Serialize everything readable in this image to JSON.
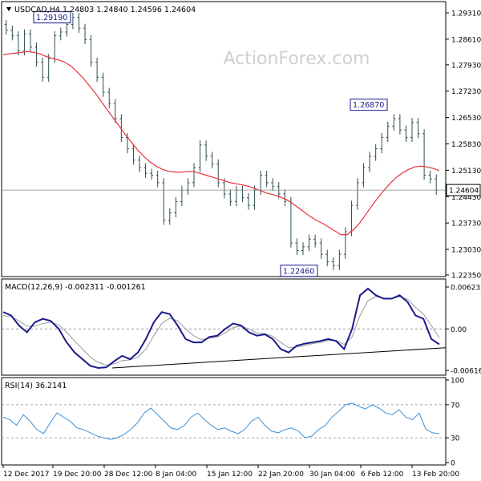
{
  "colors": {
    "background": "#ffffff",
    "frame": "#000000",
    "candle": "#2f4f4f",
    "ma": "#e8323a",
    "macd_main": "#1a1a8c",
    "macd_signal": "#9b9b9b",
    "rsi": "#3a8fd8",
    "level_line": "#8a8a8a",
    "label_border": "#1a1a8c",
    "watermark": "#d0d0d0"
  },
  "watermark": "ActionForex.com",
  "chart_data": [
    {
      "type": "candlestick",
      "title": "USDCAD,H4  1.24803 1.24840 1.24596 1.24604",
      "y_ticks": [
        "1.29310",
        "1.28610",
        "1.27930",
        "1.27230",
        "1.26530",
        "1.25830",
        "1.25130",
        "1.24430",
        "1.23730",
        "1.23030",
        "1.22350"
      ],
      "ylim": [
        1.2235,
        1.2931
      ],
      "current_price_label": "1.24604",
      "current_price": 1.24604,
      "annotations": [
        {
          "text": "1.29190",
          "value": 1.2919
        },
        {
          "text": "1.26870",
          "value": 1.2687
        },
        {
          "text": "1.22460",
          "value": 1.2246
        }
      ],
      "close": [
        1.2885,
        1.287,
        1.283,
        1.2875,
        1.284,
        1.28,
        1.276,
        1.281,
        1.287,
        1.288,
        1.29,
        1.2919,
        1.289,
        1.286,
        1.28,
        1.276,
        1.272,
        1.269,
        1.265,
        1.26,
        1.257,
        1.254,
        1.252,
        1.2505,
        1.25,
        1.248,
        1.238,
        1.24,
        1.243,
        1.246,
        1.248,
        1.252,
        1.258,
        1.255,
        1.253,
        1.248,
        1.245,
        1.243,
        1.246,
        1.244,
        1.242,
        1.246,
        1.25,
        1.248,
        1.247,
        1.245,
        1.243,
        1.232,
        1.23,
        1.231,
        1.233,
        1.232,
        1.229,
        1.227,
        1.226,
        1.229,
        1.235,
        1.242,
        1.248,
        1.252,
        1.255,
        1.257,
        1.26,
        1.263,
        1.265,
        1.262,
        1.26,
        1.264,
        1.261,
        1.25,
        1.249,
        1.246
      ],
      "ma_period_label": "",
      "ma": [
        1.282,
        1.2822,
        1.2824,
        1.2826,
        1.2828,
        1.2826,
        1.2822,
        1.2815,
        1.281,
        1.2806,
        1.28,
        1.279,
        1.2775,
        1.2758,
        1.2738,
        1.2718,
        1.2695,
        1.2672,
        1.265,
        1.2628,
        1.2605,
        1.2585,
        1.2565,
        1.2548,
        1.2534,
        1.2523,
        1.2515,
        1.251,
        1.2508,
        1.2508,
        1.251,
        1.251,
        1.2505,
        1.25,
        1.2495,
        1.249,
        1.2485,
        1.248,
        1.2477,
        1.2474,
        1.247,
        1.2464,
        1.2458,
        1.2452,
        1.2448,
        1.2443,
        1.2436,
        1.2426,
        1.2414,
        1.2402,
        1.239,
        1.238,
        1.2372,
        1.2362,
        1.2352,
        1.2342,
        1.2342,
        1.2355,
        1.2372,
        1.2395,
        1.2418,
        1.244,
        1.246,
        1.2478,
        1.2494,
        1.2506,
        1.2515,
        1.2522,
        1.2524,
        1.2522,
        1.2518,
        1.2512
      ]
    },
    {
      "type": "line",
      "title": "MACD(12,26,9) -0.002311 -0.001261",
      "y_ticks": [
        "0.006232",
        "0.00",
        "-0.006163"
      ],
      "ylim": [
        -0.006163,
        0.006232
      ],
      "main": [
        0.0025,
        0.002,
        0.0005,
        -0.0005,
        0.001,
        0.0015,
        0.0012,
        0.0,
        -0.002,
        -0.0035,
        -0.0045,
        -0.0055,
        -0.0058,
        -0.0057,
        -0.0048,
        -0.004,
        -0.0045,
        -0.0035,
        -0.0015,
        0.001,
        0.0025,
        0.0022,
        0.0005,
        -0.0015,
        -0.002,
        -0.002,
        -0.0012,
        -0.001,
        0.0,
        0.0008,
        0.0005,
        -0.0005,
        -0.001,
        -0.0008,
        -0.0015,
        -0.003,
        -0.0035,
        -0.0025,
        -0.0022,
        -0.002,
        -0.0018,
        -0.0015,
        -0.0018,
        -0.003,
        0.0,
        0.005,
        0.006,
        0.005,
        0.0045,
        0.0045,
        0.005,
        0.004,
        0.002,
        0.0015,
        -0.0015,
        -0.0023
      ],
      "signal": [
        0.002,
        0.0018,
        0.0012,
        0.0004,
        0.0004,
        0.0008,
        0.001,
        0.0006,
        -0.0005,
        -0.0018,
        -0.003,
        -0.0042,
        -0.005,
        -0.0054,
        -0.0052,
        -0.0047,
        -0.0046,
        -0.0042,
        -0.003,
        -0.001,
        0.0008,
        0.0016,
        0.0012,
        0.0,
        -0.001,
        -0.0016,
        -0.0014,
        -0.0012,
        -0.0006,
        0.0002,
        0.0004,
        0.0,
        -0.0006,
        -0.0007,
        -0.0011,
        -0.002,
        -0.0028,
        -0.0027,
        -0.0025,
        -0.0022,
        -0.002,
        -0.0017,
        -0.0017,
        -0.0023,
        -0.0012,
        0.002,
        0.0042,
        0.0048,
        0.0046,
        0.0045,
        0.0048,
        0.0044,
        0.0032,
        0.0022,
        0.0005,
        -0.0013
      ],
      "trendline": [
        [
          0.0,
          -0.0058
        ],
        [
          1.0,
          -0.0028
        ]
      ]
    },
    {
      "type": "line",
      "title": "RSI(14) 36.2141",
      "y_ticks": [
        "100",
        "70",
        "30",
        "0"
      ],
      "ylim": [
        0,
        100
      ],
      "levels": [
        70,
        30
      ],
      "values": [
        55,
        52,
        45,
        58,
        50,
        40,
        35,
        48,
        60,
        55,
        50,
        42,
        40,
        36,
        32,
        30,
        28,
        30,
        34,
        40,
        48,
        60,
        66,
        58,
        50,
        42,
        40,
        45,
        55,
        60,
        52,
        45,
        40,
        42,
        38,
        35,
        40,
        50,
        55,
        45,
        38,
        36,
        40,
        42,
        38,
        30,
        32,
        40,
        45,
        55,
        62,
        70,
        72,
        68,
        65,
        70,
        66,
        60,
        58,
        64,
        55,
        52,
        60,
        40,
        36,
        35
      ],
      "x_ticks": [
        "12 Dec 2017",
        "19 Dec 20:00",
        "28 Dec 12:00",
        "8 Jan 04:00",
        "15 Jan 12:00",
        "22 Jan 20:00",
        "30 Jan 04:00",
        "6 Feb 12:00",
        "13 Feb 20:00"
      ]
    }
  ]
}
